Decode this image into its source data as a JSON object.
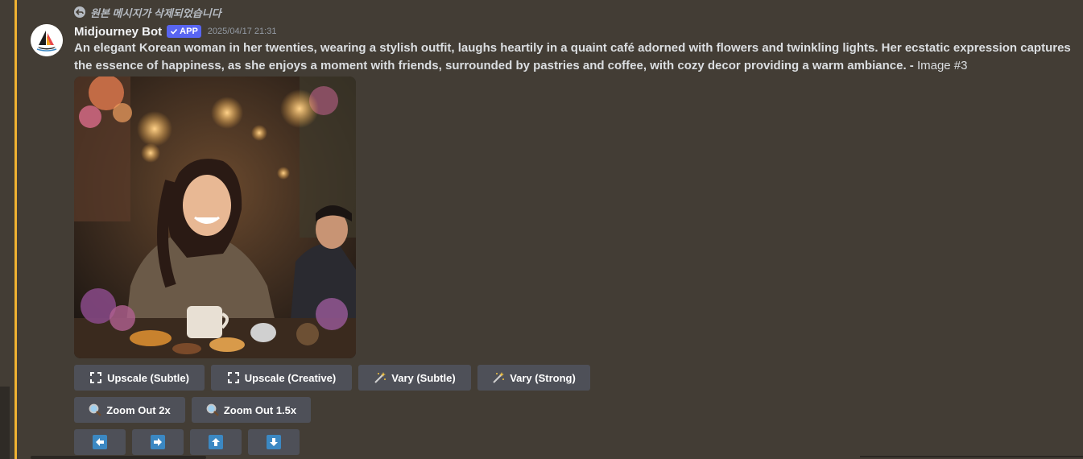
{
  "reply": {
    "text": "원본 메시지가 삭제되었습니다",
    "icon": "reply-arrow-icon"
  },
  "author": {
    "name": "Midjourney Bot",
    "badge": "APP",
    "timestamp": "2025/04/17 21:31"
  },
  "message": {
    "text": "An elegant Korean woman in her twenties, wearing a stylish outfit, laughs heartily in a quaint café adorned with flowers and twinkling lights. Her ecstatic expression captures the essence of happiness, as she enjoys a moment with friends, surrounded by pastries and coffee, with cozy decor providing a warm ambiance. -",
    "suffix": " Image #3"
  },
  "buttons": {
    "upscale_subtle": "Upscale (Subtle)",
    "upscale_creative": "Upscale (Creative)",
    "vary_subtle": "Vary (Subtle)",
    "vary_strong": "Vary (Strong)",
    "zoom_out_2x": "Zoom Out 2x",
    "zoom_out_1_5x": "Zoom Out 1.5x"
  },
  "colors": {
    "background": "#433d35",
    "highlight": "#f0b232",
    "button": "#4e5058",
    "badge": "#5865f2",
    "arrow": "#3b88c3"
  }
}
